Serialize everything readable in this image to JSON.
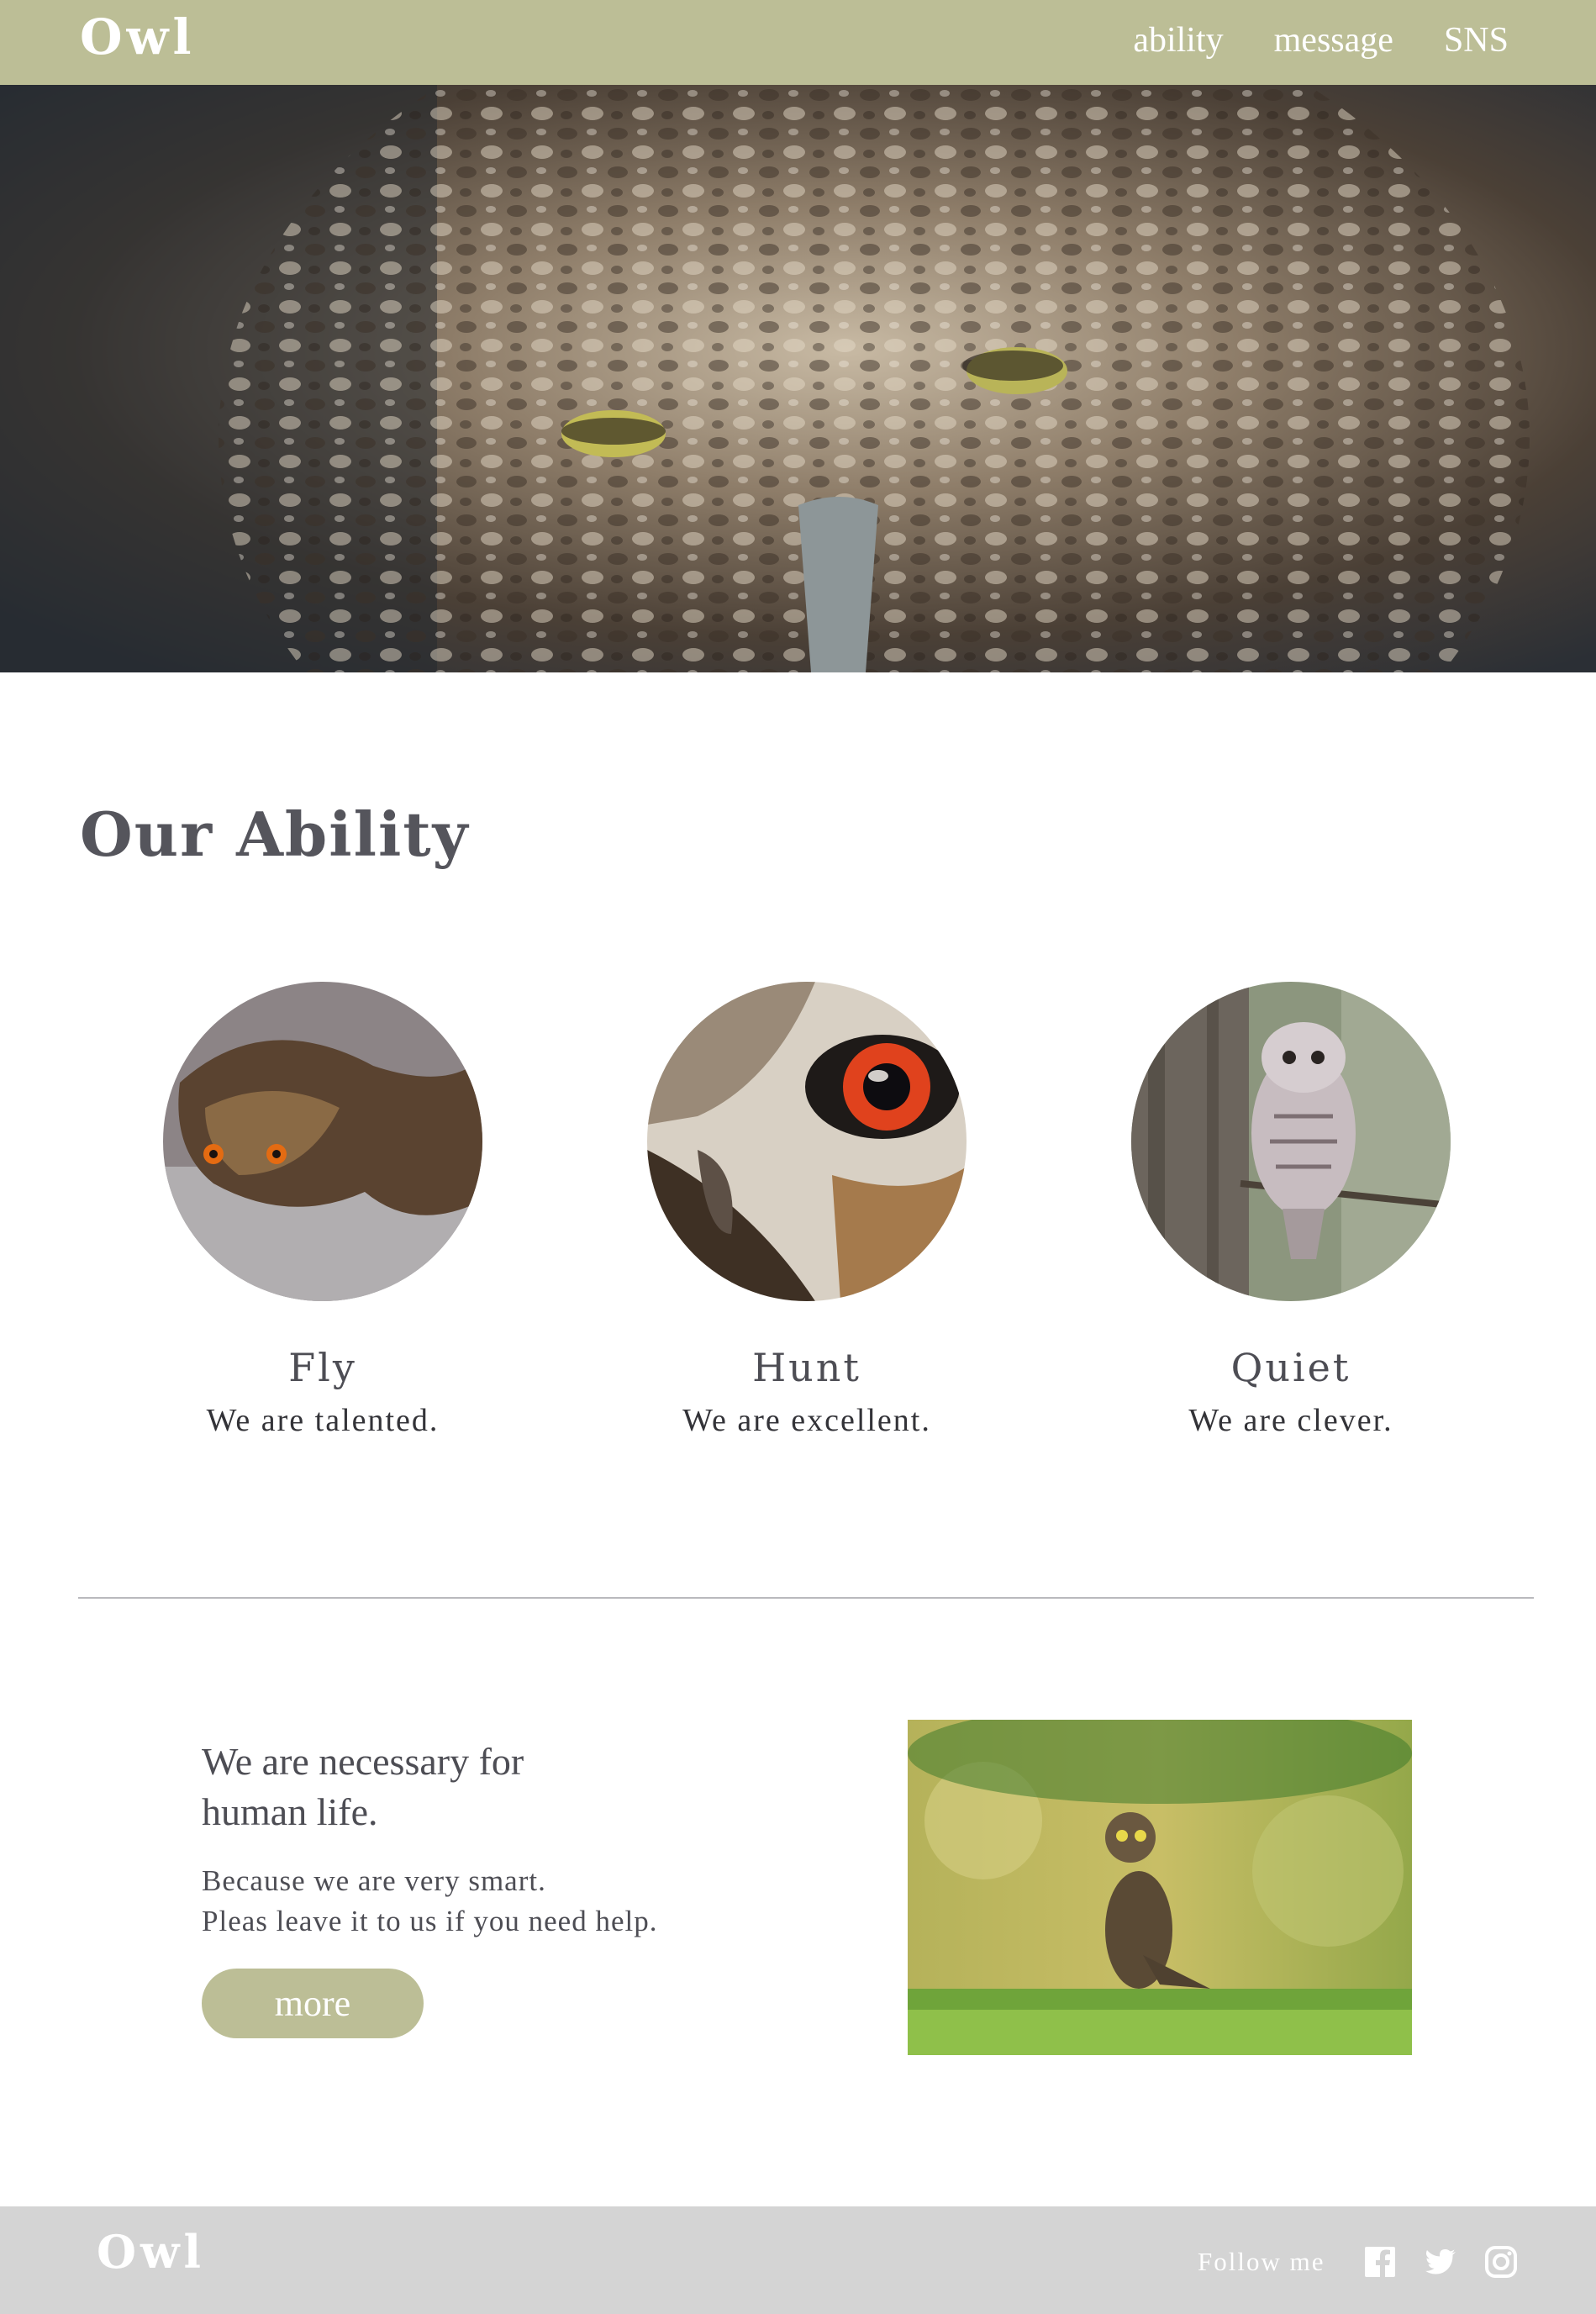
{
  "header": {
    "logo": "Owl",
    "nav": [
      "ability",
      "message",
      "SNS"
    ]
  },
  "hero": {
    "image": "owl-closeup-photo"
  },
  "ability": {
    "title": "Our Ability",
    "items": [
      {
        "label": "Fly",
        "desc": "We are talented.",
        "image": "flying-owl-photo"
      },
      {
        "label": "Hunt",
        "desc": "We are excellent.",
        "image": "owl-eye-photo"
      },
      {
        "label": "Quiet",
        "desc": "We are clever.",
        "image": "perched-owl-photo"
      }
    ]
  },
  "message": {
    "heading_line1": "We are necessary for",
    "heading_line2": "human life.",
    "text_line1": "Because we are very smart.",
    "text_line2": "Pleas leave it to us if you need help.",
    "button": "more",
    "image": "owl-in-grass-photo"
  },
  "footer": {
    "logo": "Owl",
    "follow": "Follow me",
    "social": [
      "facebook-icon",
      "twitter-icon",
      "instagram-icon"
    ]
  },
  "colors": {
    "accent": "#bcbe96",
    "text": "#4d4d54",
    "footer_bg": "#d4d4d4"
  }
}
